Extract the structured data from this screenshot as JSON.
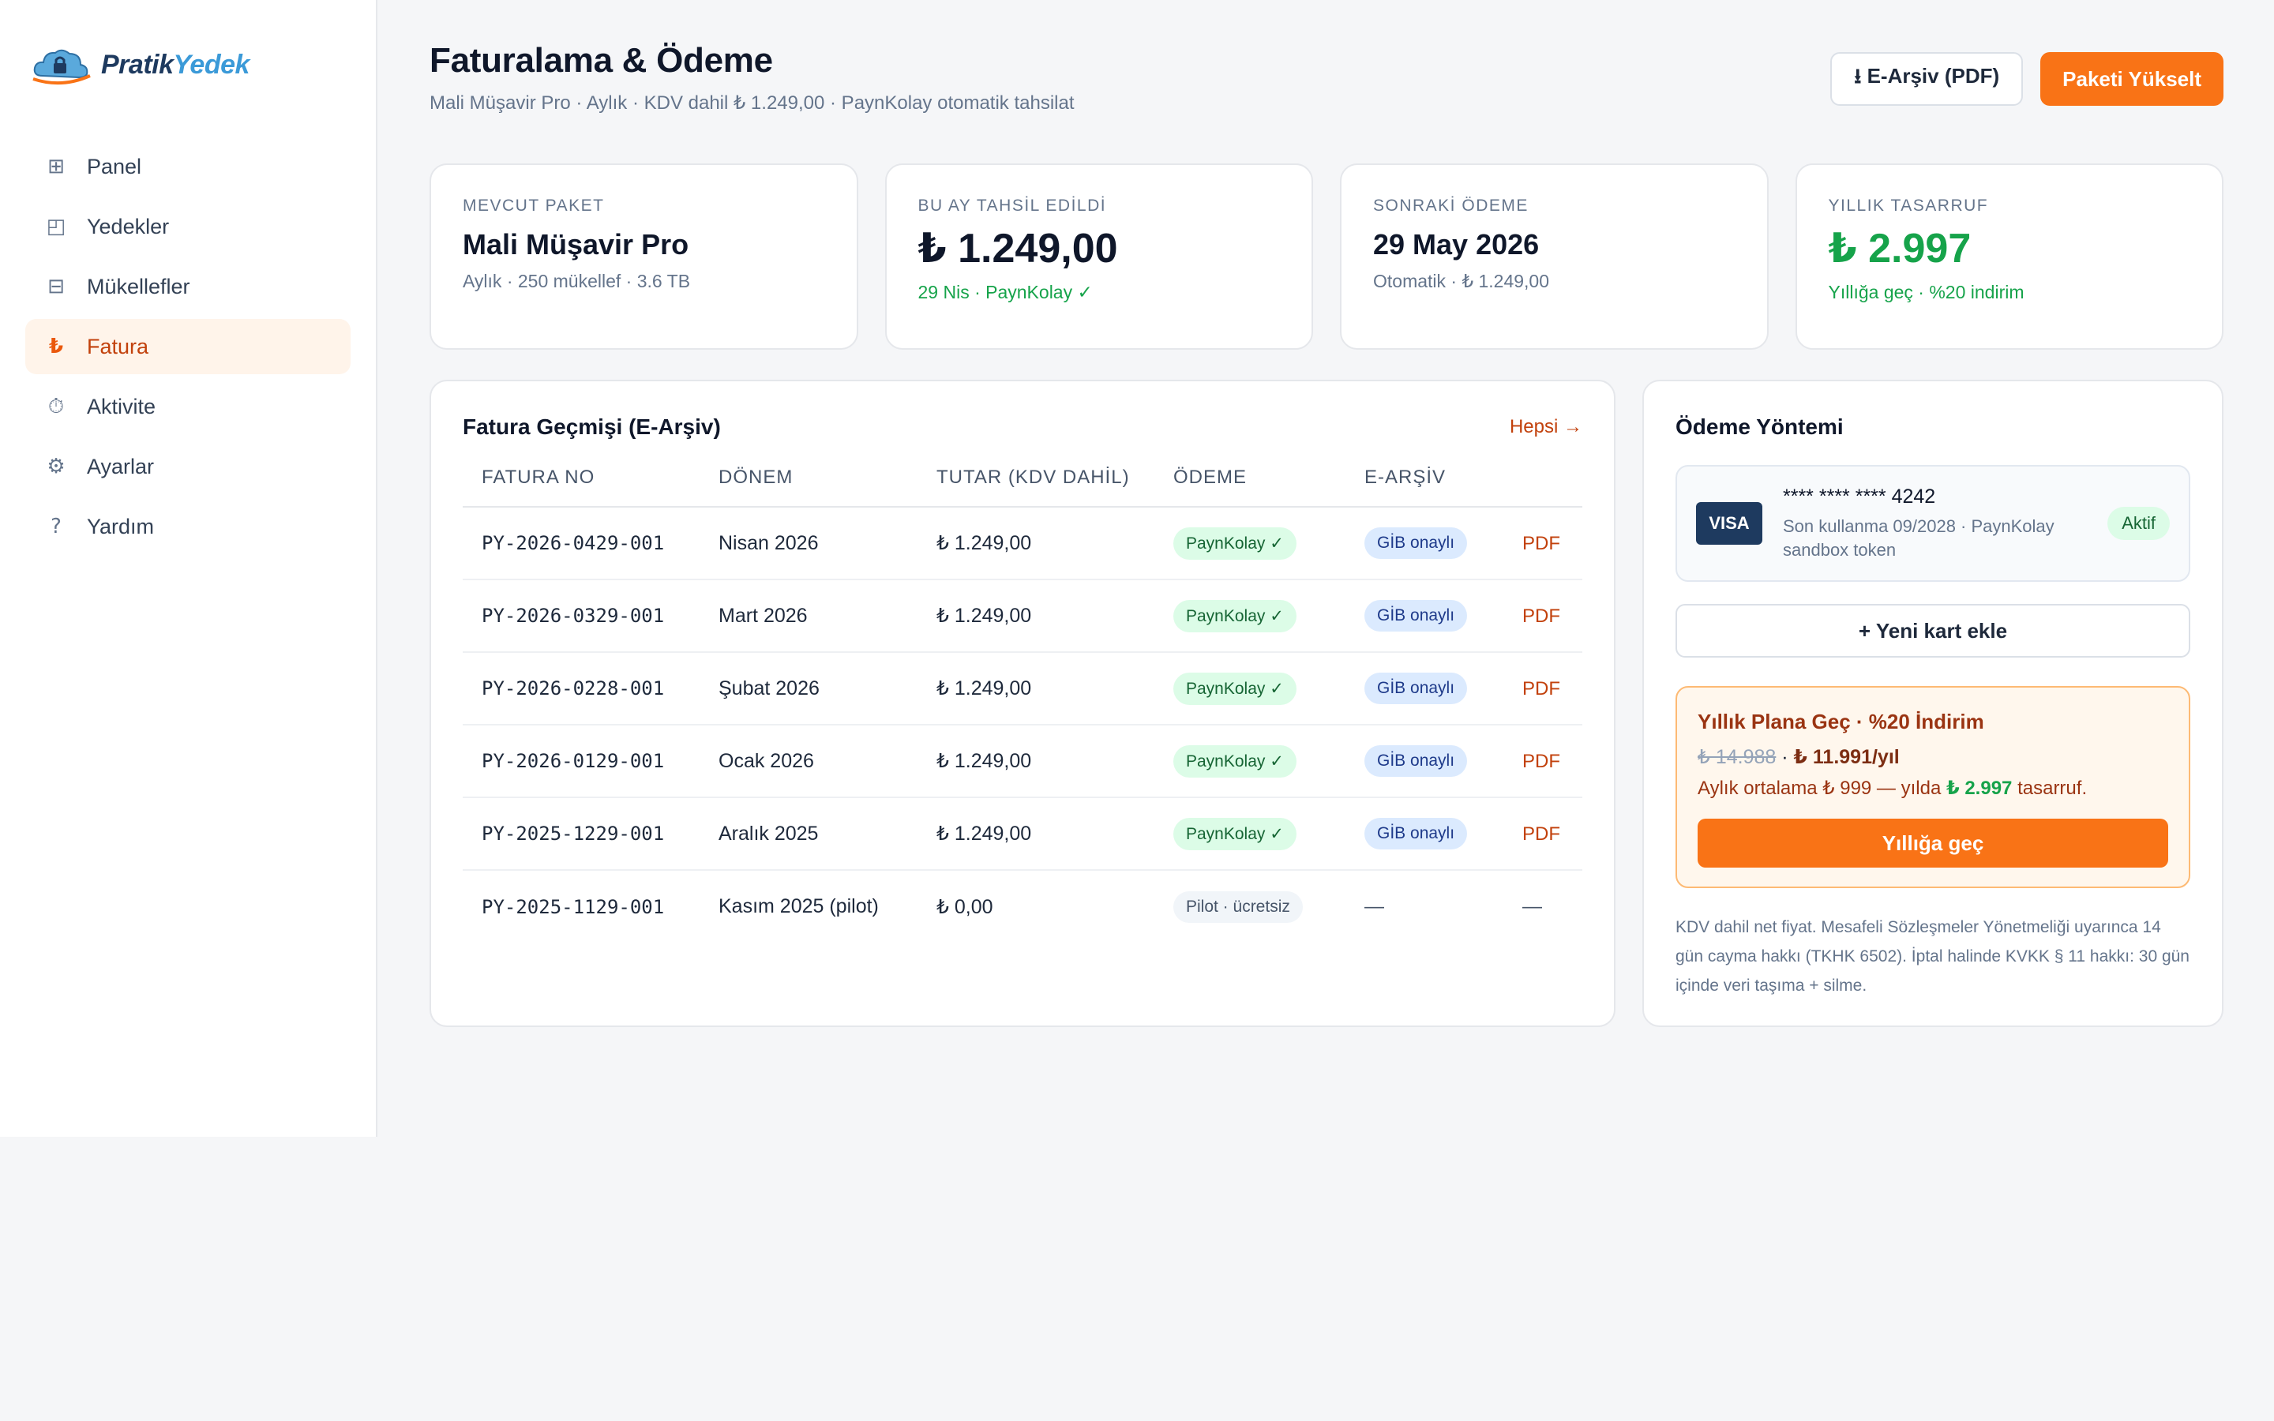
{
  "brand": {
    "name_a": "Pratik",
    "name_b": "Yedek"
  },
  "sidebar": {
    "items": [
      {
        "label": "Panel",
        "icon": "grid-icon",
        "glyph": "⊞"
      },
      {
        "label": "Yedekler",
        "icon": "backup-icon",
        "glyph": "◰"
      },
      {
        "label": "Mükellefler",
        "icon": "list-icon",
        "glyph": "⊟"
      },
      {
        "label": "Fatura",
        "icon": "lira-icon",
        "glyph": "₺",
        "active": true
      },
      {
        "label": "Aktivite",
        "icon": "stopwatch-icon",
        "glyph": "⏱"
      },
      {
        "label": "Ayarlar",
        "icon": "gear-icon",
        "glyph": "⚙"
      },
      {
        "label": "Yardım",
        "icon": "help-icon",
        "glyph": "?"
      }
    ]
  },
  "header": {
    "title": "Faturalama & Ödeme",
    "subtitle": "Mali Müşavir Pro · Aylık · KDV dahil ₺ 1.249,00 · PaynKolay otomatik tahsilat",
    "btn_archive": "⭳ E-Arşiv (PDF)",
    "btn_upgrade": "Paketi Yükselt"
  },
  "stats": {
    "plan": {
      "label": "MEVCUT PAKET",
      "value": "Mali Müşavir Pro",
      "note": "Aylık · 250 mükellef · 3.6 TB"
    },
    "collected": {
      "label": "BU AY TAHSİL EDİLDİ",
      "value": "₺ 1.249,00",
      "note": "29 Nis · PaynKolay ✓"
    },
    "next": {
      "label": "SONRAKİ ÖDEME",
      "value": "29 May 2026",
      "note": "Otomatik · ₺ 1.249,00"
    },
    "savings": {
      "label": "YILLIK TASARRUF",
      "value": "₺ 2.997",
      "note": "Yıllığa geç · %20 indirim"
    }
  },
  "invoices": {
    "title": "Fatura Geçmişi (E-Arşiv)",
    "all_link": "Hepsi →",
    "columns": [
      "FATURA NO",
      "DÖNEM",
      "TUTAR (KDV DAHİL)",
      "ÖDEME",
      "E-ARŞİV"
    ],
    "rows": [
      {
        "no": "PY-2026-0429-001",
        "period": "Nisan 2026",
        "amount": "₺ 1.249,00",
        "payment": "PaynKolay ✓",
        "archive": "GİB onaylı",
        "action": "PDF"
      },
      {
        "no": "PY-2026-0329-001",
        "period": "Mart 2026",
        "amount": "₺ 1.249,00",
        "payment": "PaynKolay ✓",
        "archive": "GİB onaylı",
        "action": "PDF"
      },
      {
        "no": "PY-2026-0228-001",
        "period": "Şubat 2026",
        "amount": "₺ 1.249,00",
        "payment": "PaynKolay ✓",
        "archive": "GİB onaylı",
        "action": "PDF"
      },
      {
        "no": "PY-2026-0129-001",
        "period": "Ocak 2026",
        "amount": "₺ 1.249,00",
        "payment": "PaynKolay ✓",
        "archive": "GİB onaylı",
        "action": "PDF"
      },
      {
        "no": "PY-2025-1229-001",
        "period": "Aralık 2025",
        "amount": "₺ 1.249,00",
        "payment": "PaynKolay ✓",
        "archive": "GİB onaylı",
        "action": "PDF"
      },
      {
        "no": "PY-2025-1129-001",
        "period": "Kasım 2025 (pilot)",
        "amount": "₺ 0,00",
        "payment": "Pilot · ücretsiz",
        "archive": "—",
        "action": "—"
      }
    ]
  },
  "payment": {
    "title": "Ödeme Yöntemi",
    "card_brand": "VISA",
    "card_number": "**** **** **** 4242",
    "card_expiry": "Son kullanma 09/2028 · PaynKolay sandbox token",
    "card_status": "Aktif",
    "add_card": "+ Yeni kart ekle",
    "promo_title": "Yıllık Plana Geç · %20 İndirim",
    "promo_old_price": "₺ 14.988",
    "promo_sep": " · ",
    "promo_new_price": "₺ 11.991/yıl",
    "promo_note_pre": "Aylık ortalama ₺ 999 — yılda ",
    "promo_note_amount": "₺ 2.997",
    "promo_note_post": " tasarruf.",
    "promo_button": "Yıllığa geç",
    "legal": "KDV dahil net fiyat. Mesafeli Sözleşmeler Yönetmeliği uyarınca 14 gün cayma hakkı (TKHK 6502). İptal halinde KVKK § 11 hakkı: 30 gün içinde veri taşıma + silme."
  },
  "colors": {
    "accent": "#f97316",
    "brand_dark": "#1e3a5f",
    "brand_light": "#3b9ad8",
    "success": "#16a34a"
  }
}
